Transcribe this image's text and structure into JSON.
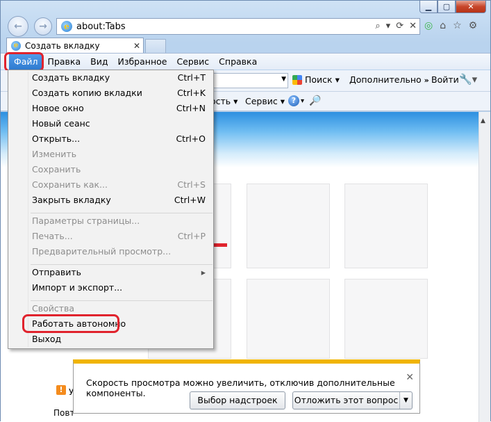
{
  "window": {
    "caption": {
      "minimize": "▁",
      "maximize": "▢",
      "close": "✕"
    }
  },
  "nav": {
    "address": "about:Tabs",
    "address_tools": [
      "⌕",
      "▾",
      "⟳",
      "✕"
    ],
    "right_icons": [
      "◎",
      "⌂",
      "☆",
      "⚙"
    ]
  },
  "tab": {
    "label": "Создать вкладку",
    "close": "✕"
  },
  "menubar": {
    "items": [
      "Файл",
      "Правка",
      "Вид",
      "Избранное",
      "Сервис",
      "Справка"
    ]
  },
  "commandbar": {
    "search_label": "Поиск",
    "more_label": "Дополнительно",
    "login_label": "Войти",
    "safety_label": "ость",
    "service_label": "Сервис"
  },
  "file_menu": {
    "items": [
      {
        "label": "Создать вкладку",
        "shortcut": "Ctrl+T",
        "disabled": false
      },
      {
        "label": "Создать копию вкладки",
        "shortcut": "Ctrl+K",
        "disabled": false
      },
      {
        "label": "Новое окно",
        "shortcut": "Ctrl+N",
        "disabled": false
      },
      {
        "label": "Новый сеанс",
        "shortcut": "",
        "disabled": false
      },
      {
        "label": "Открыть...",
        "shortcut": "Ctrl+O",
        "disabled": false
      },
      {
        "label": "Изменить",
        "shortcut": "",
        "disabled": true
      },
      {
        "label": "Сохранить",
        "shortcut": "",
        "disabled": true
      },
      {
        "label": "Сохранить как...",
        "shortcut": "Ctrl+S",
        "disabled": true
      },
      {
        "label": "Закрыть вкладку",
        "shortcut": "Ctrl+W",
        "disabled": false
      },
      {
        "label": "Параметры страницы...",
        "shortcut": "",
        "disabled": true
      },
      {
        "label": "Печать...",
        "shortcut": "Ctrl+P",
        "disabled": true
      },
      {
        "label": "Предварительный просмотр...",
        "shortcut": "",
        "disabled": true
      },
      {
        "label": "Отправить",
        "shortcut": "",
        "disabled": false,
        "submenu": true
      },
      {
        "label": "Импорт и экспорт...",
        "shortcut": "",
        "disabled": false
      },
      {
        "label": "Свойства",
        "shortcut": "",
        "disabled": true
      },
      {
        "label": "Работать автономно",
        "shortcut": "",
        "disabled": false
      },
      {
        "label": "Выход",
        "shortcut": "",
        "disabled": false
      }
    ]
  },
  "notification": {
    "text": "Скорость просмотра можно увеличить, отключив дополнительные компоненты.",
    "addons_button": "Выбор надстроек",
    "later_button": "Отложить этот вопрос"
  },
  "peek": {
    "text1": "У",
    "text2": "Повт"
  },
  "colors": {
    "highlight_red": "#e0232d",
    "menu_active": "#3a86dc",
    "notif_bar": "#f0b400"
  }
}
